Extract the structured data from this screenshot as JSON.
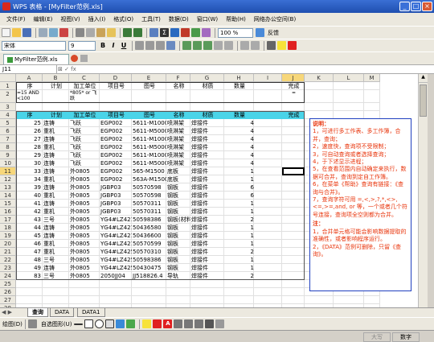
{
  "window": {
    "title": "WPS 表格 - [MyFilter范例.xls]",
    "min": "_",
    "max": "□",
    "close": "×"
  },
  "menu": [
    "文件(F)",
    "编辑(E)",
    "视图(V)",
    "插入(I)",
    "格式(O)",
    "工具(T)",
    "数据(D)",
    "窗口(W)",
    "帮助(H)",
    "网络办公空间(B)"
  ],
  "toolbar": {
    "zoom": "100 %",
    "feedback": "反馈",
    "font_name": "宋体",
    "font_size": "9"
  },
  "doc_tab": "MyFilter范例.xls",
  "namebox": "J11",
  "columns": [
    "A",
    "B",
    "C",
    "D",
    "E",
    "F",
    "G",
    "H",
    "I",
    "J",
    "K",
    "L",
    "M"
  ],
  "criteria": {
    "row1": [
      "序",
      "计划",
      "加工单位",
      "项目号",
      "图号",
      "名称",
      "材质",
      "数量",
      "",
      "完成"
    ],
    "row2": [
      "=15 AND <100",
      "",
      "*805* or 飞跃",
      "",
      "",
      "",
      "",
      "",
      "",
      "="
    ]
  },
  "table_header": [
    "序",
    "计划",
    "加工单位",
    "项目号",
    "图号",
    "名称",
    "材质",
    "数量",
    "",
    "完成"
  ],
  "rows": [
    [
      "25",
      "连铸",
      "飞跃",
      "EGP002",
      "5611-M1000",
      "喷淋架",
      "焊接件",
      "4"
    ],
    [
      "26",
      "重机",
      "飞跃",
      "EGP002",
      "5611-M5000",
      "喷淋架",
      "焊接件",
      "4"
    ],
    [
      "27",
      "连铸",
      "飞跃",
      "EGP002",
      "5611-M1000",
      "喷淋架",
      "焊接件",
      "4"
    ],
    [
      "28",
      "重机",
      "飞跃",
      "EGP002",
      "5611-M5000",
      "喷淋架",
      "焊接件",
      "4"
    ],
    [
      "29",
      "连铸",
      "飞跃",
      "EGP002",
      "5611-M1000",
      "喷淋架",
      "焊接件",
      "4"
    ],
    [
      "30",
      "连铸",
      "飞跃",
      "EGP002",
      "5611-M5000",
      "喷淋架",
      "焊接件",
      "4"
    ],
    [
      "33",
      "连铸",
      "外0805",
      "EGP002",
      "565-M1500",
      "底板",
      "焊接件",
      "1"
    ],
    [
      "34",
      "重机",
      "外0805",
      "EGP002",
      "563A-M1500",
      "底板",
      "焊接件",
      "1"
    ],
    [
      "39",
      "连铸",
      "外0805",
      "JGBP03",
      "50570598",
      "钢板",
      "焊接件",
      "6"
    ],
    [
      "40",
      "重机",
      "外0805",
      "JGBP03",
      "50570598",
      "钢板",
      "焊接件",
      "6"
    ],
    [
      "41",
      "连铸",
      "外0805",
      "JGBP03",
      "50570311",
      "钢板",
      "焊接件",
      "1"
    ],
    [
      "42",
      "重机",
      "外0805",
      "JGBP03",
      "50570311",
      "钢板",
      "焊接件",
      "1"
    ],
    [
      "43",
      "三号",
      "外0805",
      "YG4#LZ421",
      "50598386",
      "钢板(材料)",
      "焊接件",
      "2"
    ],
    [
      "44",
      "连铸",
      "外0805",
      "YG4#LZ421",
      "50436580",
      "钢板",
      "焊接件",
      "1"
    ],
    [
      "45",
      "连铸",
      "外0805",
      "YG4#LZ421",
      "50436600",
      "钢板",
      "焊接件",
      "1"
    ],
    [
      "46",
      "重机",
      "外0805",
      "YG4#LZ421",
      "50570599",
      "钢板",
      "焊接件",
      "1"
    ],
    [
      "47",
      "重机",
      "外0805",
      "YG4#LZ425",
      "50570310",
      "钢板",
      "焊接件",
      "2"
    ],
    [
      "48",
      "三号",
      "外0805",
      "YG4#LZ425",
      "50598386",
      "钢板",
      "焊接件",
      "1"
    ],
    [
      "49",
      "连铸",
      "外0805",
      "YG4#LZ425",
      "50430475",
      "钢板",
      "焊接件",
      "1"
    ],
    [
      "83",
      "三号",
      "外0805",
      "2050JJ04",
      "JJ518826.4",
      "导轨",
      "焊接件",
      "2"
    ]
  ],
  "row_numbers": [
    "1",
    "2",
    "3",
    "4",
    "5",
    "6",
    "7",
    "8",
    "9",
    "10",
    "11",
    "12",
    "13",
    "14",
    "15",
    "16",
    "17",
    "18",
    "19",
    "20",
    "21",
    "22",
    "23",
    "24",
    "25",
    "26",
    "27",
    "28"
  ],
  "note": {
    "title": "说明：",
    "lines": [
      "1，可进行多工作表、多工作簿，合并，查询；",
      "2，速度快，查询项不受限制；",
      "3，可自动查询或者选择查询；",
      "4，于下述显示进程；",
      "5，在查看范围内自动确定来执行，数据可合并，查询到定自工作簿。",
      "6，在菜单《帮助》查询有链接：《查询与合并》。",
      "7，查询字符可用 =,<,>,?,*,<>,<=,>=,and, or 等，一个或者几个符号连接，查询项全空则都为合并。"
    ],
    "remark_title": "注：",
    "remarks": [
      "1，合并单元格可能会影响数据提取的准确性，或者影响程序运行。",
      "2，《DATA》范例可删除，只留《查询》。"
    ]
  },
  "sheets": [
    "查询",
    "DATA",
    "DATA1"
  ],
  "drawbar": {
    "draw": "绘图(D)",
    "autoshape": "自选图形(U)"
  },
  "status": {
    "caps": "大写",
    "num": "数字"
  }
}
